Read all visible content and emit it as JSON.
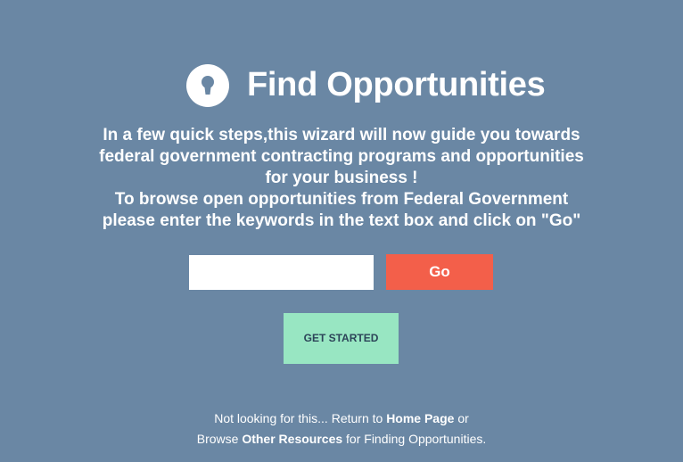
{
  "header": {
    "icon": "keyhole-icon",
    "title": "Find Opportunities"
  },
  "intro": {
    "lines": [
      "In a few quick steps,this wizard will now guide you towards",
      "federal government contracting programs and opportunities",
      "for your business !",
      "To browse open opportunities from Federal Government",
      "please enter the keywords in the text box and click on \"Go\""
    ]
  },
  "search": {
    "value": "",
    "placeholder": "",
    "go_label": "Go"
  },
  "actions": {
    "get_started_label": "GET STARTED"
  },
  "footer": {
    "line1_prefix": "Not looking for this... Return to ",
    "home_link": "Home Page",
    "line1_suffix": " or",
    "line2_prefix": "Browse ",
    "resources_link": "Other Resources",
    "line2_suffix": " for Finding Opportunities."
  },
  "colors": {
    "background": "#6a87a4",
    "go_button": "#f35f4a",
    "get_started_button": "#98e6c2",
    "get_started_text": "#2c4458",
    "text": "#ffffff"
  }
}
